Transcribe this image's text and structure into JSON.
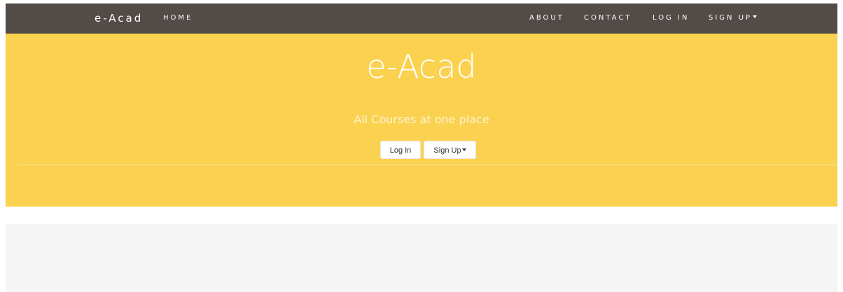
{
  "navbar": {
    "brand": "e-Acad",
    "home": "HOME",
    "about": "ABOUT",
    "contact": "CONTACT",
    "login": "LOG IN",
    "signup": "SIGN UP"
  },
  "hero": {
    "title": "e-Acad",
    "subtitle": "All Courses at one place",
    "login_button": "Log In",
    "signup_button": "Sign Up"
  },
  "icons": {
    "dropdown": "caret-down-icon"
  },
  "colors": {
    "navbar_bg": "#524b47",
    "hero_bg": "#fad250",
    "content_bg": "#f5f5f5",
    "text_light": "#ffffff"
  }
}
